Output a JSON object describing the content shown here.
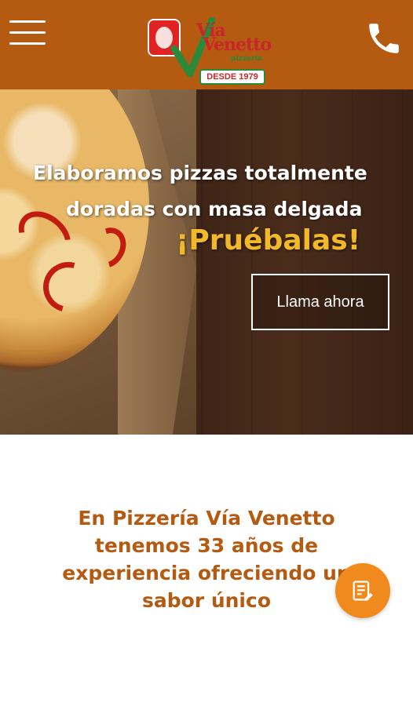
{
  "header": {
    "menu_icon": "hamburger-menu-icon",
    "phone_icon": "phone-icon",
    "logo": {
      "line1": "Vía",
      "line2": "Venetto",
      "subtitle": "pizzería",
      "since": "DESDE 1979"
    }
  },
  "hero": {
    "line1": "Elaboramos pizzas totalmente",
    "line2": "doradas con masa delgada",
    "highlight": "¡Pruébalas!",
    "cta_label": "Llama ahora"
  },
  "about": {
    "lines": [
      "En Pizzería Vía Venetto",
      "tenemos 33 años de",
      "experiencia ofreciendo un",
      "sabor único"
    ]
  },
  "fab": {
    "icon": "menu-list-icon"
  },
  "colors": {
    "header_bg": "#b45a11",
    "accent_orange": "#f08a1c",
    "highlight_yellow": "#f1b829",
    "about_text": "#b45a11"
  }
}
